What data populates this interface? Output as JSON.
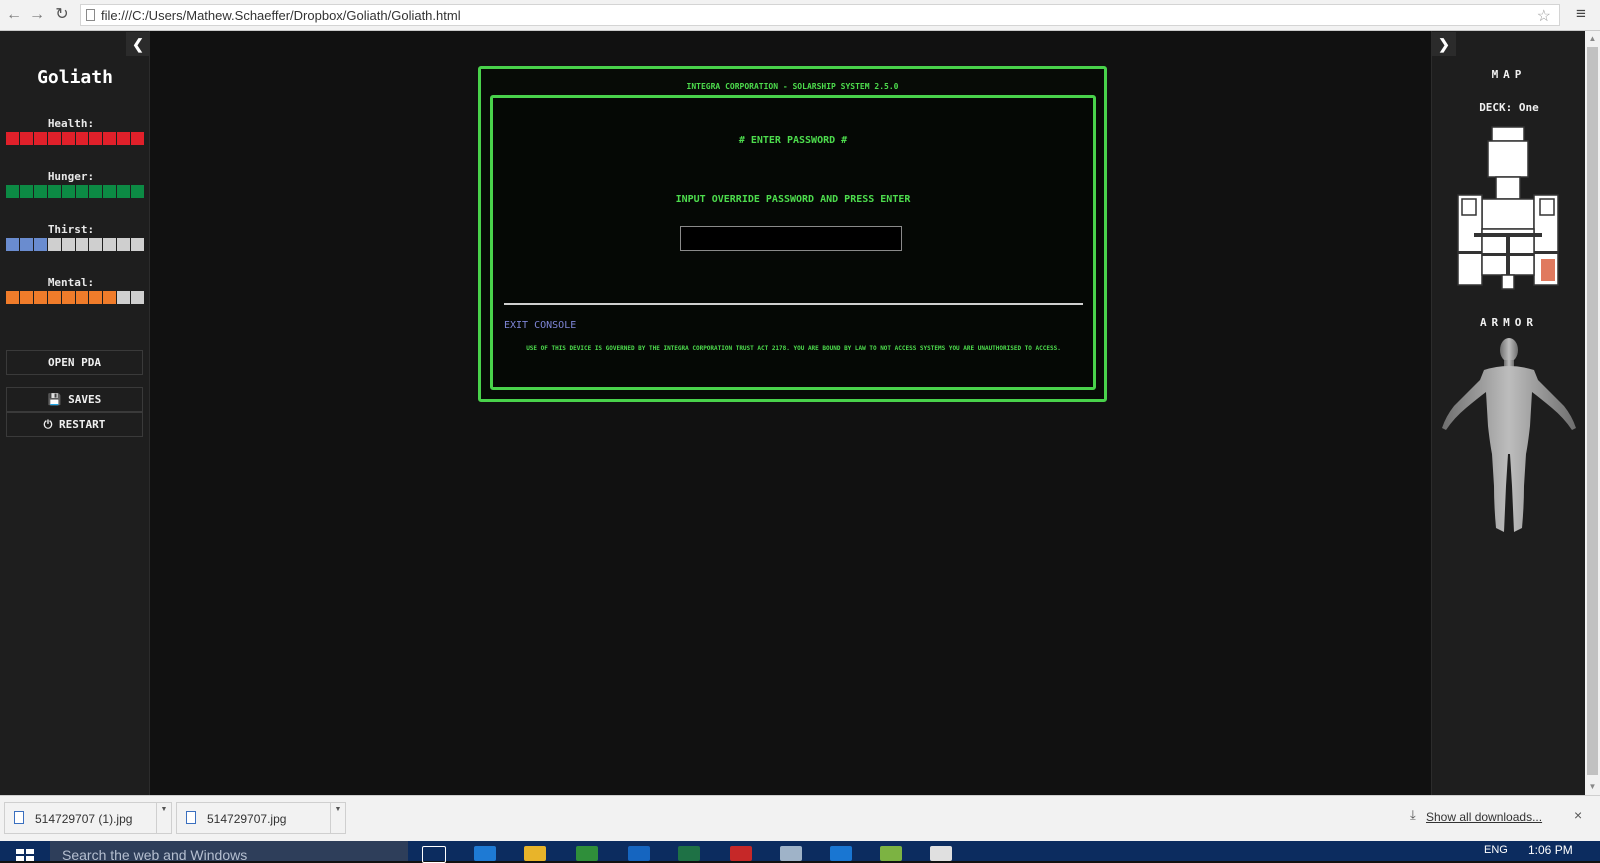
{
  "browser": {
    "url": "file:///C:/Users/Mathew.Schaeffer/Dropbox/Goliath/Goliath.html",
    "back_icon": "arrow-left",
    "forward_icon": "arrow-right",
    "reload_icon": "reload",
    "star_icon": "star",
    "menu_icon": "hamburger"
  },
  "left_sidebar": {
    "title": "Goliath",
    "stats": [
      {
        "label": "Health:",
        "level": 1.0,
        "color": "#e0202a",
        "empty_color": "#cfcfcf"
      },
      {
        "label": "Hunger:",
        "level": 1.0,
        "color": "#0c8a44",
        "empty_color": "#cfcfcf"
      },
      {
        "label": "Thirst:",
        "level": 0.3,
        "color": "#6a8ccf",
        "empty_color": "#cfcfcf"
      },
      {
        "label": "Mental:",
        "level": 0.8,
        "color": "#f07c2a",
        "empty_color": "#cfcfcf"
      }
    ],
    "buttons": {
      "open_pda": "OPEN PDA",
      "saves": "SAVES",
      "restart": "RESTART"
    }
  },
  "terminal": {
    "header": "INTEGRA CORPORATION - SOLARSHIP SYSTEM 2.5.0",
    "prompt_title": "# ENTER PASSWORD #",
    "instruction": "INPUT OVERRIDE PASSWORD AND PRESS ENTER",
    "password_value": "",
    "exit_link": "EXIT CONSOLE",
    "legal": "USE OF THIS DEVICE IS GOVERNED BY THE INTEGRA CORPORATION TRUST ACT 2178. YOU ARE BOUND BY LAW TO NOT ACCESS SYSTEMS YOU ARE UNAUTHORISED TO ACCESS.",
    "accent_color": "#49d24b"
  },
  "right_sidebar": {
    "map_heading": "MAP",
    "deck_label": "DECK: One",
    "armor_heading": "ARMOR"
  },
  "downloads": {
    "items": [
      {
        "name": "514729707 (1).jpg"
      },
      {
        "name": "514729707.jpg"
      }
    ],
    "show_all": "Show all downloads..."
  },
  "taskbar": {
    "search_placeholder": "Search the web and Windows",
    "language": "ENG",
    "time": "1:06 PM"
  }
}
